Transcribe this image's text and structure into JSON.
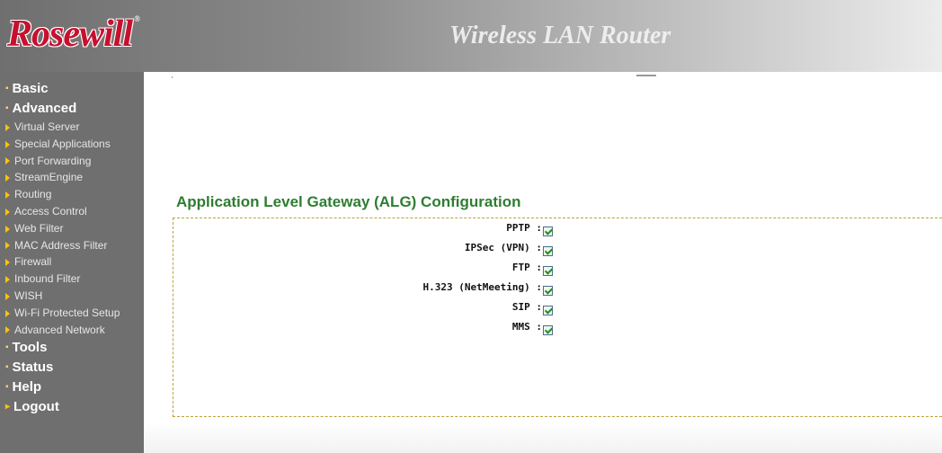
{
  "header": {
    "brand": "Rosewill",
    "product": "Wireless LAN Router"
  },
  "sidebar": {
    "sections": [
      {
        "label": "Basic"
      },
      {
        "label": "Advanced",
        "items": [
          "Virtual Server",
          "Special Applications",
          "Port Forwarding",
          "StreamEngine",
          "Routing",
          "Access Control",
          "Web Filter",
          "MAC Address Filter",
          "Firewall",
          "Inbound Filter",
          "WISH",
          "Wi-Fi Protected Setup",
          "Advanced Network"
        ]
      },
      {
        "label": "Tools"
      },
      {
        "label": "Status"
      },
      {
        "label": "Help"
      },
      {
        "label": "Logout"
      }
    ]
  },
  "alg": {
    "title": "Application Level Gateway (ALG) Configuration",
    "options": [
      {
        "label": "PPTP :",
        "checked": true
      },
      {
        "label": "IPSec (VPN) :",
        "checked": true
      },
      {
        "label": "FTP :",
        "checked": true
      },
      {
        "label": "H.323 (NetMeeting) :",
        "checked": true
      },
      {
        "label": "SIP :",
        "checked": true
      },
      {
        "label": "MMS :",
        "checked": true
      }
    ]
  },
  "colors": {
    "title_green": "#2e7d32",
    "sidebar_bg": "#6f6f6f",
    "brand_red": "#c8102e",
    "arrow_orange": "#ffc20a"
  }
}
